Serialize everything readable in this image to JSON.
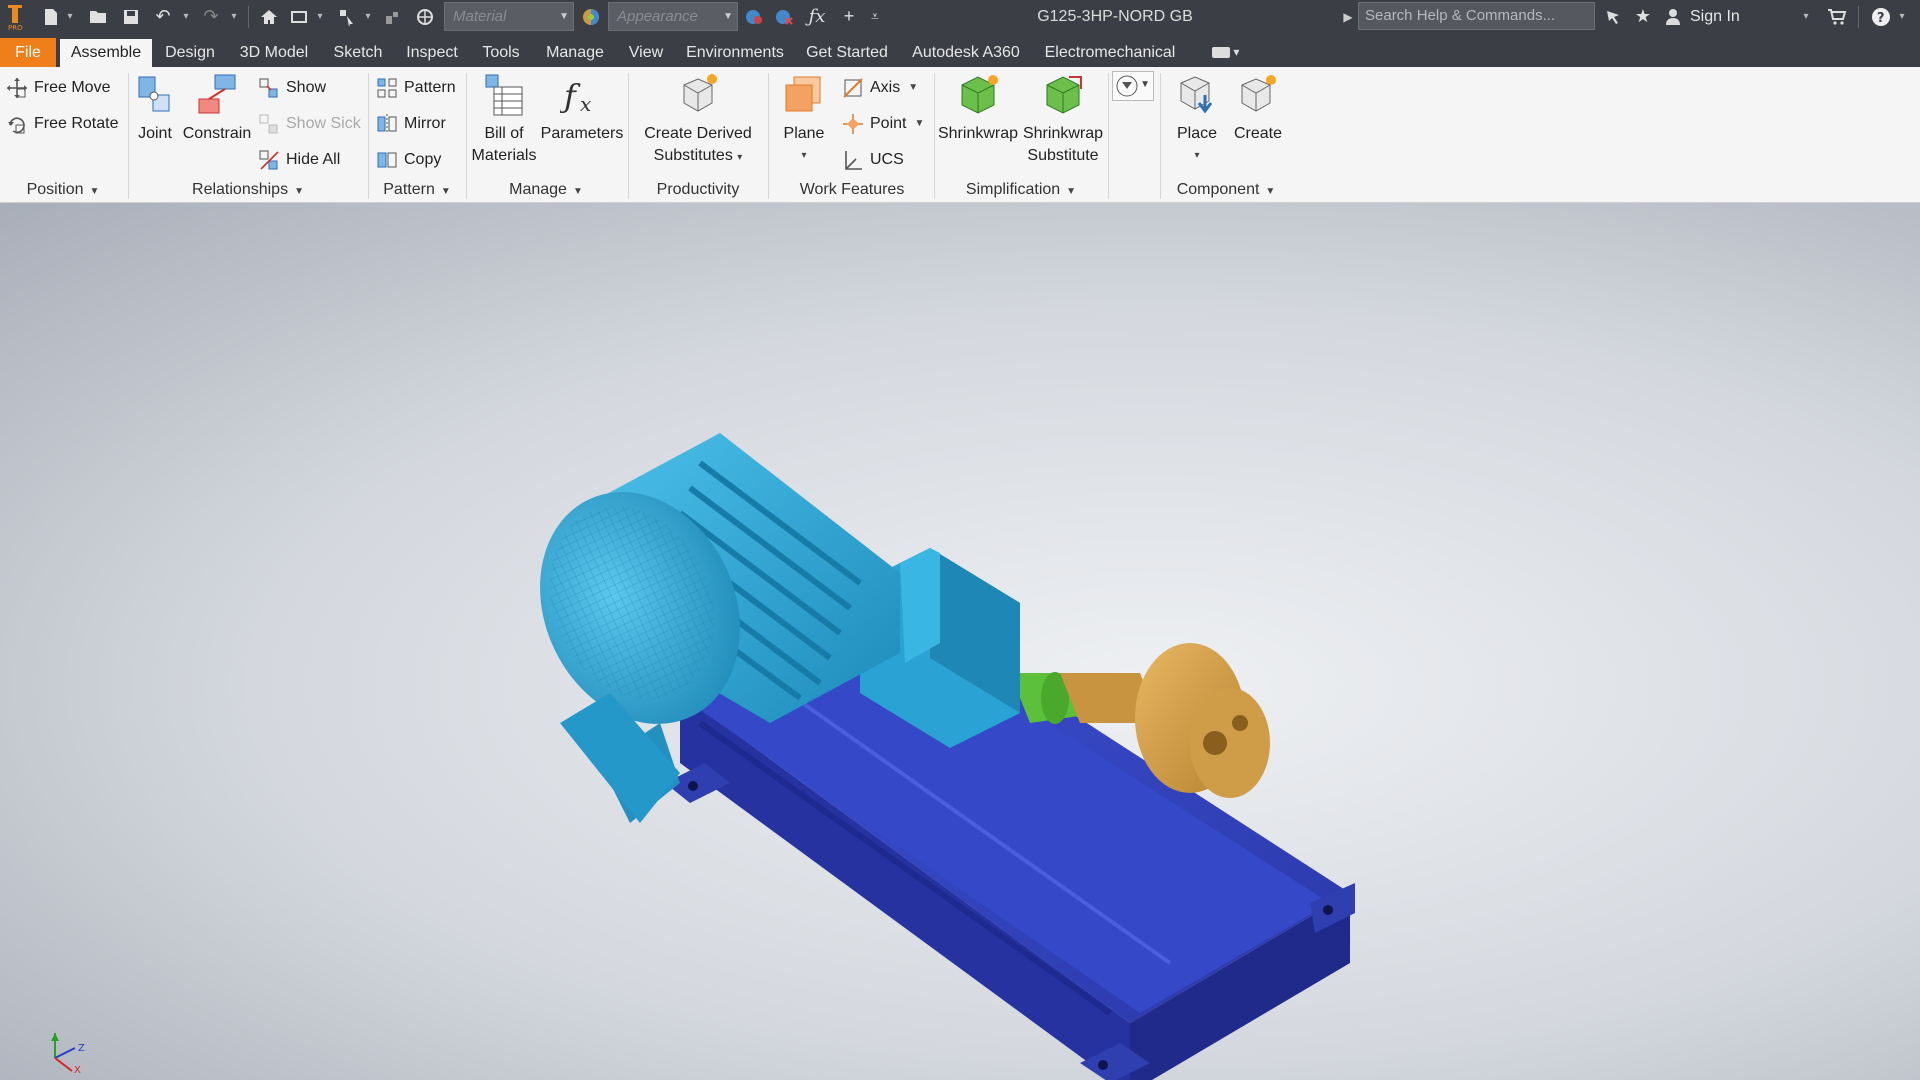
{
  "window": {
    "document_title": "G125-3HP-NORD GB",
    "material_placeholder": "Material",
    "appearance_placeholder": "Appearance",
    "search_placeholder": "Search Help & Commands...",
    "sign_in": "Sign In",
    "app_icon": "inventor-pro-icon"
  },
  "tabs": [
    {
      "label": "File",
      "state": "file"
    },
    {
      "label": "Assemble",
      "state": "active"
    },
    {
      "label": "Design",
      "state": "normal"
    },
    {
      "label": "3D Model",
      "state": "normal"
    },
    {
      "label": "Sketch",
      "state": "normal"
    },
    {
      "label": "Inspect",
      "state": "normal"
    },
    {
      "label": "Tools",
      "state": "normal"
    },
    {
      "label": "Manage",
      "state": "normal"
    },
    {
      "label": "View",
      "state": "normal"
    },
    {
      "label": "Environments",
      "state": "normal"
    },
    {
      "label": "Get Started",
      "state": "normal"
    },
    {
      "label": "Autodesk A360",
      "state": "normal"
    },
    {
      "label": "Electromechanical",
      "state": "normal"
    }
  ],
  "ribbon": {
    "position": {
      "title": "Position",
      "free_move": "Free Move",
      "free_rotate": "Free Rotate"
    },
    "relationships": {
      "title": "Relationships",
      "joint": "Joint",
      "constrain": "Constrain",
      "show": "Show",
      "show_sick": "Show Sick",
      "hide_all": "Hide All"
    },
    "pattern": {
      "title": "Pattern",
      "pattern": "Pattern",
      "mirror": "Mirror",
      "copy": "Copy"
    },
    "manage": {
      "title": "Manage",
      "bom_line1": "Bill of",
      "bom_line2": "Materials",
      "parameters": "Parameters"
    },
    "productivity": {
      "title": "Productivity",
      "derived_line1": "Create Derived",
      "derived_line2": "Substitutes"
    },
    "work_features": {
      "title": "Work Features",
      "plane": "Plane",
      "axis": "Axis",
      "point": "Point",
      "ucs": "UCS"
    },
    "simplification": {
      "title": "Simplification",
      "shrinkwrap": "Shrinkwrap",
      "shrinkwrap_sub_line1": "Shrinkwrap",
      "shrinkwrap_sub_line2": "Substitute"
    },
    "component": {
      "title": "Component",
      "place": "Place",
      "create": "Create"
    }
  },
  "colors": {
    "file_tab": "#ef7f1a",
    "title_bar": "#3b3f45",
    "motor": "#2aa8d8",
    "base_frame": "#2f3fb0",
    "pump": "#d9a04a",
    "coupling": "#5cc03a"
  }
}
